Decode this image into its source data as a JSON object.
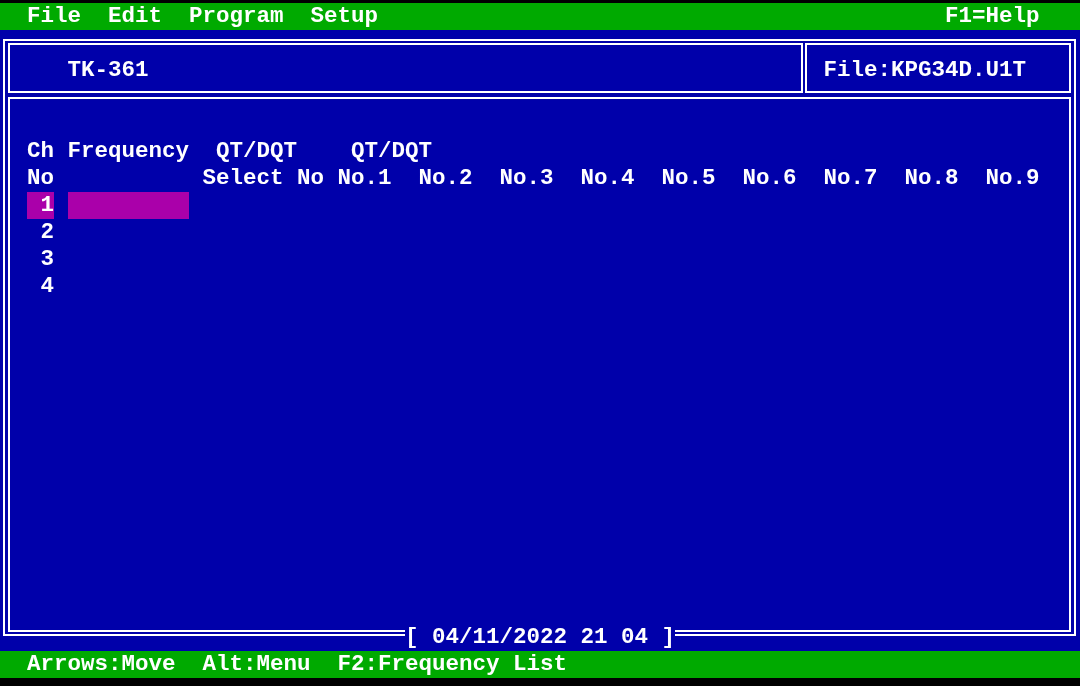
{
  "menu_bar": {
    "items": [
      "File",
      "Edit",
      "Program",
      "Setup"
    ],
    "help": "F1=Help"
  },
  "header": {
    "model": "TK-361",
    "file": "File:KPG34D.U1T"
  },
  "channel_table": {
    "columns": [
      {
        "title": "Ch",
        "subtitle": "No"
      },
      {
        "title": "Frequency"
      },
      {
        "title": "QT/DQT",
        "subtitle": "Select No"
      },
      {
        "title": "QT/DQT",
        "subtitle": "No.1"
      },
      {
        "subtitle": "No.2"
      },
      {
        "subtitle": "No.3"
      },
      {
        "subtitle": "No.4"
      },
      {
        "subtitle": "No.5"
      },
      {
        "subtitle": "No.6"
      },
      {
        "subtitle": "No.7"
      },
      {
        "subtitle": "No.8"
      },
      {
        "subtitle": "No.9"
      }
    ],
    "rows": [
      {
        "ch": "1",
        "selected": true
      },
      {
        "ch": "2",
        "selected": false
      },
      {
        "ch": "3",
        "selected": false
      },
      {
        "ch": "4",
        "selected": false
      }
    ]
  },
  "footer_label": "[ 04/11/2022 21 04 ]",
  "status_bar": {
    "hints": [
      "Arrows:Move",
      "Alt:Menu",
      "F2:Frequency List"
    ]
  }
}
